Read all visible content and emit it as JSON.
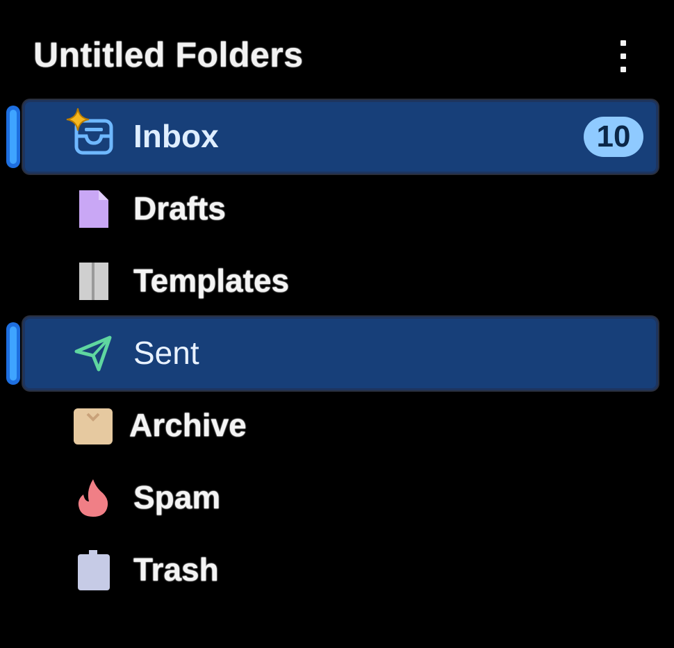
{
  "header": {
    "title": "Untitled Folders"
  },
  "folders": [
    {
      "id": "inbox",
      "label": "Inbox",
      "icon": "inbox-tray-icon",
      "badge": "10",
      "selected": true
    },
    {
      "id": "drafts",
      "label": "Drafts",
      "icon": "draft-document-icon",
      "selected": false
    },
    {
      "id": "templates",
      "label": "Templates",
      "icon": "template-icon",
      "selected": false
    },
    {
      "id": "sent",
      "label": "Sent",
      "icon": "paper-plane-icon",
      "selected": true
    },
    {
      "id": "archive",
      "label": "Archive",
      "icon": "archive-box-icon",
      "selected": false
    },
    {
      "id": "spam",
      "label": "Spam",
      "icon": "flame-icon",
      "selected": false
    },
    {
      "id": "trash",
      "label": "Trash",
      "icon": "trash-can-icon",
      "selected": false
    }
  ],
  "colors": {
    "selection_bg": "#173f79",
    "selection_indicator": "#3fa4ff",
    "badge_bg": "#8fcaff",
    "inbox_icon": "#6fb8ff",
    "sparkle": "#f6b81f",
    "drafts_icon": "#c9a7f5",
    "templates_icon": "#cfcfcf",
    "sent_icon": "#5fd6a0",
    "archive_icon": "#e6c9a0",
    "spam_icon": "#f07f86",
    "trash_icon": "#c6cbe6"
  }
}
